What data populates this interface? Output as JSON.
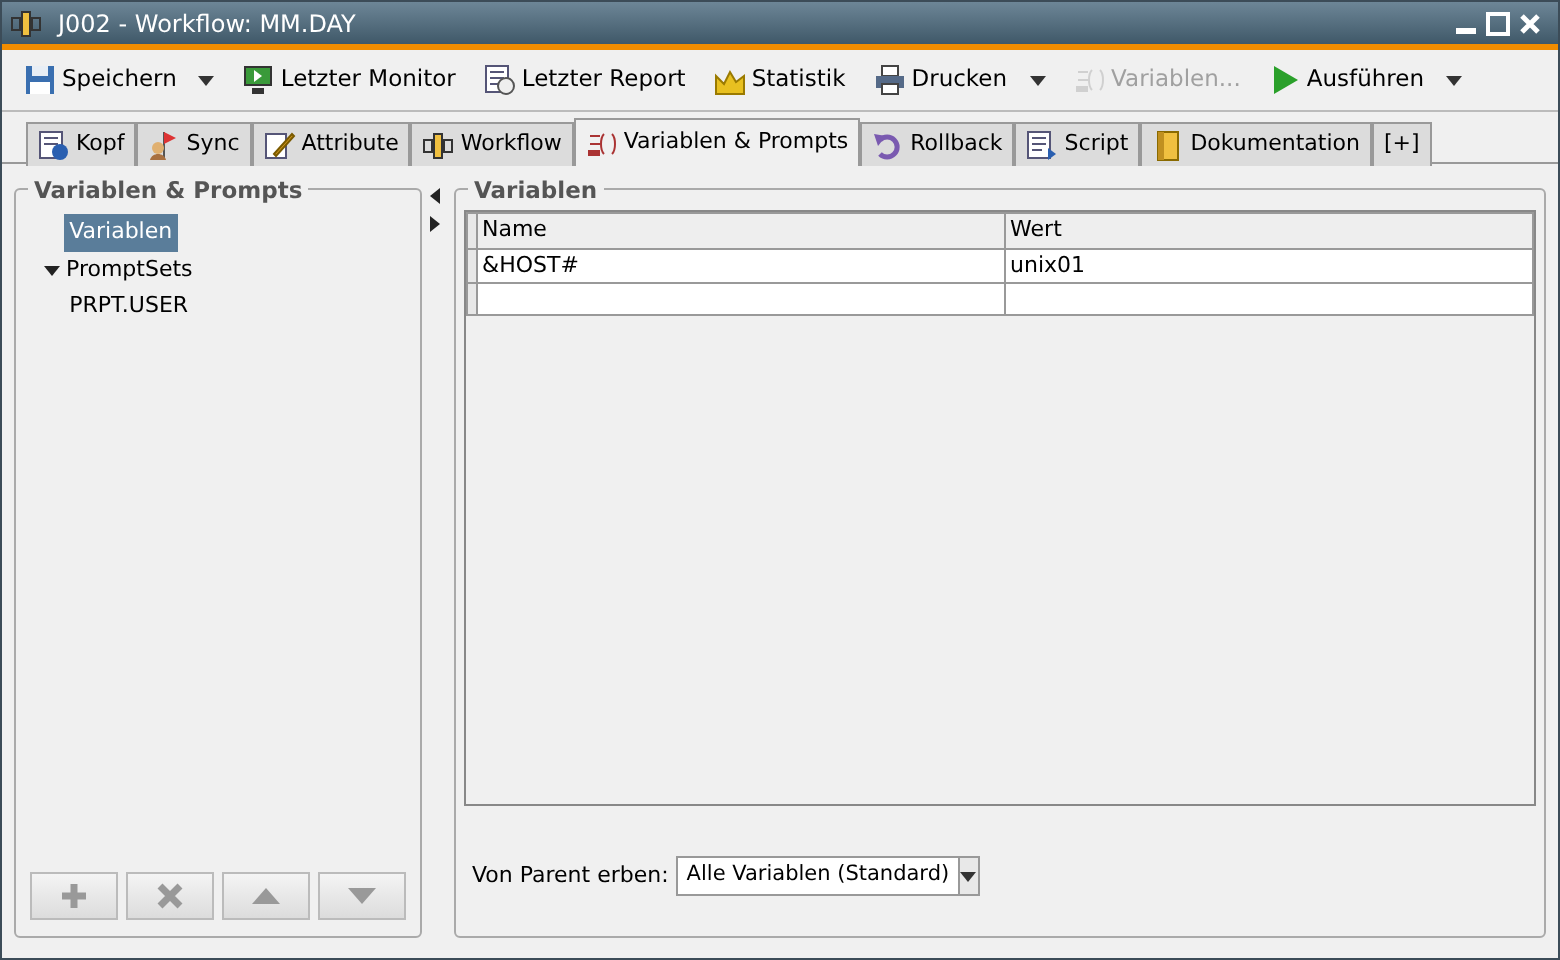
{
  "window": {
    "title": "J002 - Workflow: MM.DAY"
  },
  "toolbar": [
    {
      "label": "Speichern",
      "dropdown": true,
      "disabled": false
    },
    {
      "label": "Letzter Monitor",
      "dropdown": false,
      "disabled": false
    },
    {
      "label": "Letzter Report",
      "dropdown": false,
      "disabled": false
    },
    {
      "label": "Statistik",
      "dropdown": false,
      "disabled": false
    },
    {
      "label": "Drucken",
      "dropdown": true,
      "disabled": false
    },
    {
      "label": "Variablen...",
      "dropdown": false,
      "disabled": true
    },
    {
      "label": "Ausführen",
      "dropdown": true,
      "disabled": false
    }
  ],
  "tabs": [
    {
      "label": "Kopf",
      "selected": false
    },
    {
      "label": "Sync",
      "selected": false
    },
    {
      "label": "Attribute",
      "selected": false
    },
    {
      "label": "Workflow",
      "selected": false
    },
    {
      "label": "Variablen & Prompts",
      "selected": true
    },
    {
      "label": "Rollback",
      "selected": false
    },
    {
      "label": "Script",
      "selected": false
    },
    {
      "label": "Dokumentation",
      "selected": false
    },
    {
      "label": "[+]",
      "selected": false
    }
  ],
  "sidebar": {
    "title": "Variablen & Prompts",
    "tree": [
      {
        "label": "Variablen",
        "selected": true
      },
      {
        "label": "PromptSets",
        "selected": false,
        "expanded": true,
        "children": [
          {
            "label": "PRPT.USER",
            "selected": false
          }
        ]
      }
    ],
    "buttons": [
      {
        "kind": "plus",
        "disabled": true
      },
      {
        "kind": "delete",
        "disabled": true
      },
      {
        "kind": "up",
        "disabled": true
      },
      {
        "kind": "down",
        "disabled": true
      }
    ]
  },
  "variables": {
    "title": "Variablen",
    "table": {
      "columns": [
        "Name",
        "Wert"
      ],
      "rows": [
        [
          "&HOST#",
          "unix01"
        ]
      ]
    },
    "inherit": {
      "label": "Von Parent erben:",
      "value": "Alle Variablen (Standard)"
    }
  }
}
